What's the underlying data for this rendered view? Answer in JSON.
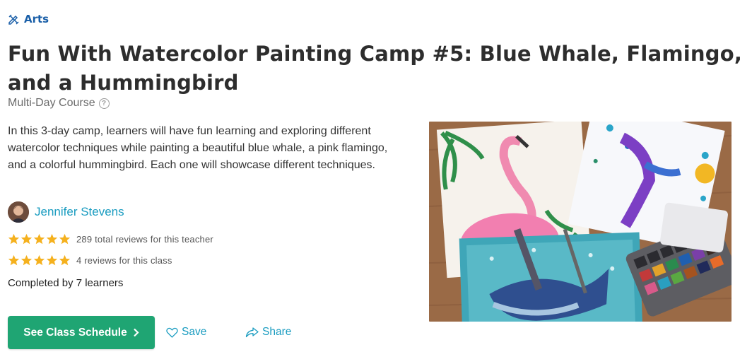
{
  "category": {
    "icon": "pencil-ruler-icon",
    "label": "Arts"
  },
  "title": "Fun With Watercolor Painting Camp #5: Blue Whale, Flamingo, and a Hummingbird",
  "course_type": {
    "label": "Multi-Day Course",
    "help_icon_glyph": "?"
  },
  "description": "In this 3-day camp, learners will have fun learning and exploring different watercolor techniques while painting a beautiful blue whale, a pink flamingo, and a colorful hummingbird. Each one will showcase different techniques.",
  "teacher": {
    "name": "Jennifer Stevens"
  },
  "ratings": [
    {
      "stars": 5,
      "text": "289 total reviews for this teacher"
    },
    {
      "stars": 5,
      "text": "4 reviews for this class"
    }
  ],
  "completed": "Completed by 7 learners",
  "actions": {
    "schedule_label": "See Class Schedule",
    "save_label": "Save",
    "share_label": "Share"
  },
  "colors": {
    "accent_blue": "#1a5fa8",
    "link": "#1a9cc0",
    "primary_button": "#1fa573",
    "star": "#f5b11e"
  }
}
